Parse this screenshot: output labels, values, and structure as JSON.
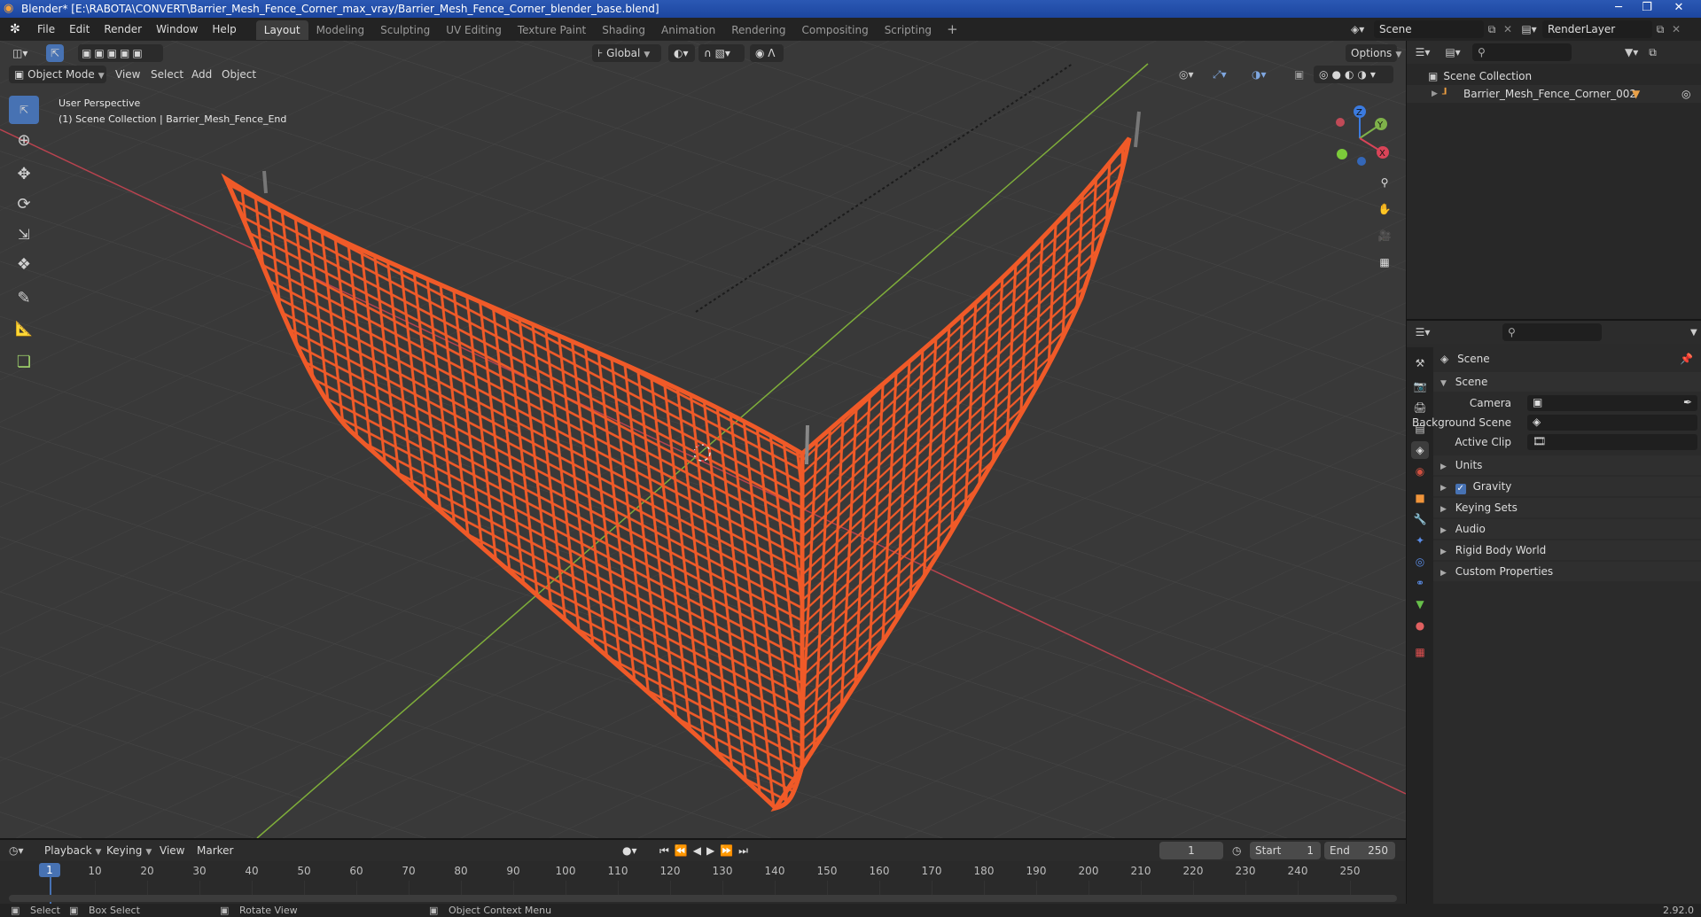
{
  "window": {
    "title": "Blender* [E:\\RABOTA\\CONVERT\\Barrier_Mesh_Fence_Corner_max_vray/Barrier_Mesh_Fence_Corner_blender_base.blend]",
    "minimize_glyph": "─",
    "restore_glyph": "❐",
    "close_glyph": "✕"
  },
  "menubar": {
    "menus": [
      "File",
      "Edit",
      "Render",
      "Window",
      "Help"
    ],
    "workspace_tabs": [
      "Layout",
      "Modeling",
      "Sculpting",
      "UV Editing",
      "Texture Paint",
      "Shading",
      "Animation",
      "Rendering",
      "Compositing",
      "Scripting"
    ],
    "active_tab": "Layout",
    "add_tab_glyph": "+",
    "scene_label": "Scene",
    "render_layer_label": "RenderLayer"
  },
  "viewport": {
    "mode": "Object Mode",
    "menus": [
      "View",
      "Select",
      "Add",
      "Object"
    ],
    "transform_orientation": "Global",
    "options_label": "Options",
    "overlay_line1": "User Perspective",
    "overlay_line2": "(1) Scene Collection | Barrier_Mesh_Fence_End",
    "gizmo_labels": {
      "z": "Z",
      "y": "Y",
      "x": "X"
    },
    "fence_color": "#f05a28",
    "grid_color": "#454545",
    "x_axis_color": "#b8434f",
    "y_axis_color": "#7fae3a"
  },
  "outliner": {
    "collection": "Scene Collection",
    "object": "Barrier_Mesh_Fence_Corner_002"
  },
  "properties": {
    "context": "Scene",
    "panel": "Scene",
    "fields": [
      {
        "label": "Camera",
        "icon": "camera-icon"
      },
      {
        "label": "Background Scene",
        "icon": "scene-icon"
      },
      {
        "label": "Active Clip",
        "icon": "clip-icon"
      }
    ],
    "subpanels": [
      "Units",
      "Gravity",
      "Keying Sets",
      "Audio",
      "Rigid Body World",
      "Custom Properties"
    ],
    "gravity_checked": true
  },
  "timeline": {
    "menus": [
      "Playback",
      "Keying",
      "View",
      "Marker"
    ],
    "current_frame": "1",
    "start_label": "Start",
    "start_value": "1",
    "end_label": "End",
    "end_value": "250",
    "ruler": [
      "1",
      "10",
      "20",
      "30",
      "40",
      "50",
      "60",
      "70",
      "80",
      "90",
      "100",
      "110",
      "120",
      "130",
      "140",
      "150",
      "160",
      "170",
      "180",
      "190",
      "200",
      "210",
      "220",
      "230",
      "240",
      "250"
    ]
  },
  "statusbar": {
    "items": [
      "Select",
      "Box Select",
      "Rotate View",
      "Object Context Menu"
    ],
    "version": "2.92.0"
  }
}
